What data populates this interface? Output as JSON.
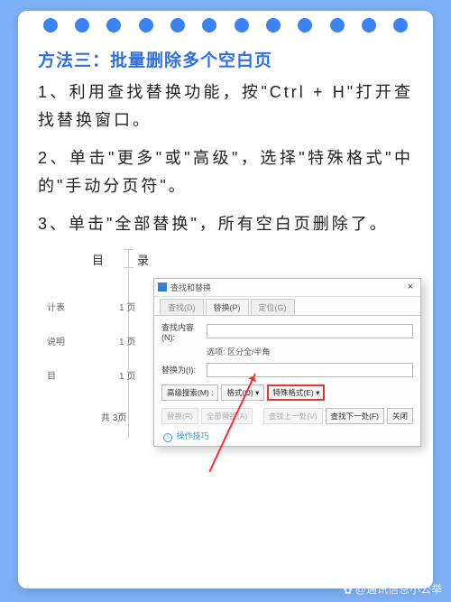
{
  "title": "方法三：批量删除多个空白页",
  "steps": {
    "s1": "1、利用查找替换功能，按\"Ctrl + H\"打开查找替换窗口。",
    "s2": "2、单击\"更多\"或\"高级\"，选择\"特殊格式\"中的\"手动分页符\"。",
    "s3": "3、单击\"全部替换\"，所有空白页删除了。"
  },
  "toc": {
    "heading": "目　录",
    "rows": [
      {
        "label": "计表",
        "page": "1 页"
      },
      {
        "label": "说明",
        "page": "1 页"
      },
      {
        "label": "目",
        "page": "1 页"
      }
    ],
    "total": "共 3页"
  },
  "dialog": {
    "title": "查找和替换",
    "tabs": {
      "find": "查找(D)",
      "replace": "替换(P)",
      "goto": "定位(G)"
    },
    "find_label": "查找内容(N):",
    "options_label": "选项:",
    "options_value": "区分全/半角",
    "replace_label": "替换为(I):",
    "btn_adv": "高级搜索(M) :",
    "btn_format": "格式(O) ▾",
    "btn_special": "特殊格式(E) ▾",
    "btn_replace": "替换(R)",
    "btn_replace_all": "全部替换(A)",
    "btn_find_prev": "查找上一处(V)",
    "btn_find_next": "查找下一处(F)",
    "btn_close": "关闭",
    "hint": "操作技巧"
  },
  "watermark": "@通讯信息小公举"
}
